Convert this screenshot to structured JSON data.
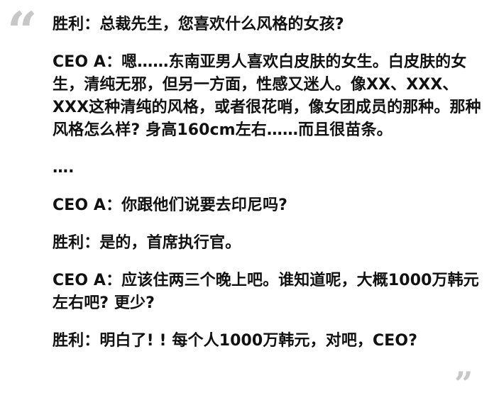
{
  "quotes": {
    "open": "“",
    "close": "”"
  },
  "dialogue": [
    {
      "speaker": "胜利",
      "separator": "：",
      "text": "总裁先生，您喜欢什么风格的女孩?"
    },
    {
      "speaker": "CEO A",
      "separator": "：",
      "text": "嗯……东南亚男人喜欢白皮肤的女生。白皮肤的女生，清纯无邪，但另一方面，性感又迷人。像XX、XXX、XXX这种清纯的风格，或者很花哨，像女团成员的那种。那种风格怎么样? 身高160cm左右……而且很苗条。"
    },
    {
      "speaker": "",
      "separator": "",
      "text": "…."
    },
    {
      "speaker": "CEO A",
      "separator": "：",
      "text": "你跟他们说要去印尼吗?"
    },
    {
      "speaker": "胜利",
      "separator": "：",
      "text": "是的，首席执行官。"
    },
    {
      "speaker": "CEO A",
      "separator": "：",
      "text": "应该住两三个晚上吧。谁知道呢，大概1000万韩元左右吧? 更少?"
    },
    {
      "speaker": "胜利",
      "separator": "：",
      "text": "明白了! ! 每个人1000万韩元，对吧，CEO?"
    }
  ]
}
